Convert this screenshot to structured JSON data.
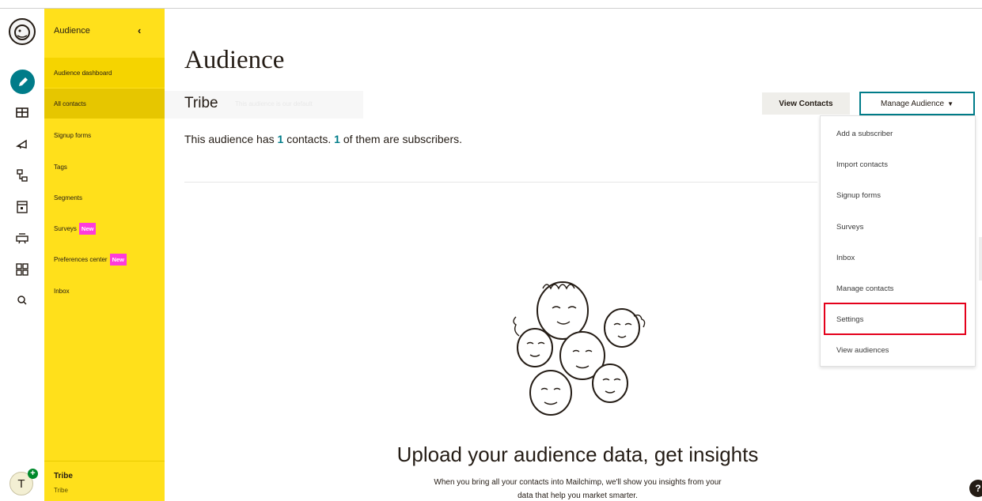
{
  "sidebar": {
    "header": "Audience",
    "collapse_icon": "chevron-left-icon",
    "items": [
      {
        "label": "Audience dashboard"
      },
      {
        "label": "All contacts"
      },
      {
        "label": "Signup forms"
      },
      {
        "label": "Tags"
      },
      {
        "label": "Segments"
      },
      {
        "label": "Surveys",
        "badge": "New"
      },
      {
        "label": "Preferences center",
        "badge": "New"
      },
      {
        "label": "Inbox"
      }
    ],
    "account_name": "Tribe",
    "account_sub": "Tribe"
  },
  "rail": {
    "avatar_letter": "T",
    "icons": [
      "mailchimp-logo-icon",
      "create-pencil-icon",
      "audience-icon",
      "campaigns-icon",
      "automations-icon",
      "website-icon",
      "integrations-icon",
      "content-grid-icon",
      "search-icon"
    ]
  },
  "main": {
    "title": "Audience",
    "audience_name": "Tribe",
    "faded_sub": "This audience is our default",
    "desc_prefix": "This audience has ",
    "contacts": "1",
    "desc_mid": " contacts. ",
    "subscribers": "1",
    "desc_suffix": " of them are subscribers.",
    "view_contacts": "View Contacts",
    "manage_audience": "Manage Audience",
    "headline": "Upload your audience data, get insights",
    "body_line1": "When you bring all your contacts into Mailchimp, we'll show you insights from your",
    "body_line2": "data that help you market smarter."
  },
  "menu": {
    "items": [
      "Add a subscriber",
      "Import contacts",
      "Signup forms",
      "Surveys",
      "Inbox",
      "Manage contacts",
      "Settings",
      "View audiences"
    ],
    "highlighted": "Settings"
  },
  "help_label": "?",
  "colors": {
    "sidebar": "#ffe01b",
    "accent": "#007c89",
    "badge": "#ff3cdb",
    "highlight": "#e4001b"
  }
}
